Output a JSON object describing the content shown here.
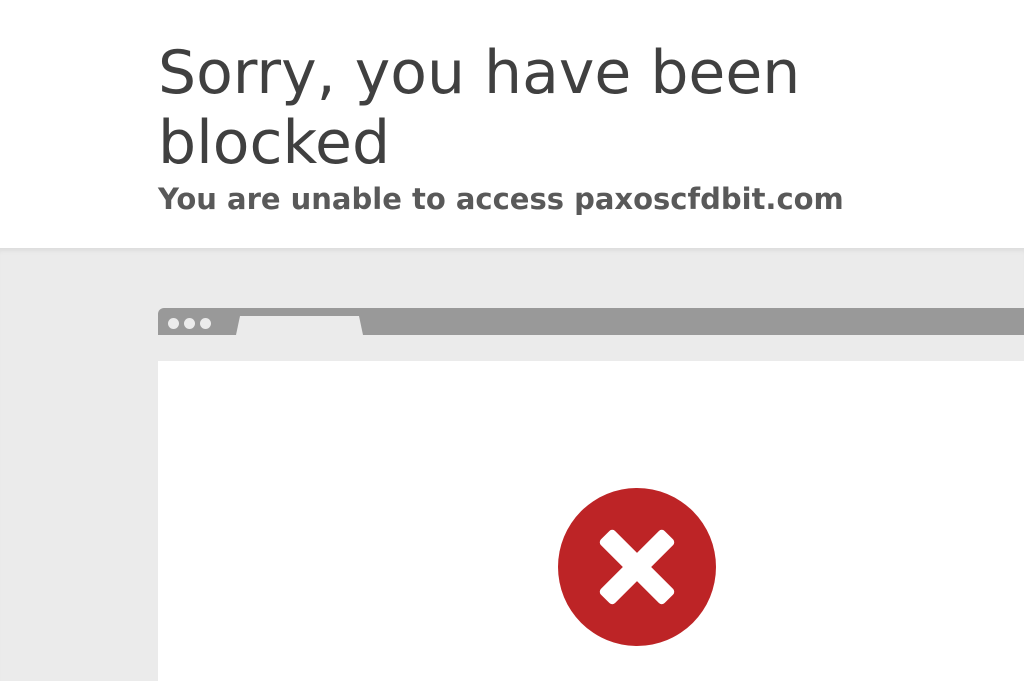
{
  "header": {
    "title": "Sorry, you have been blocked",
    "subtitle": "You are unable to access paxoscfdbit.com"
  },
  "icons": {
    "browser_dots": "three-dots-icon",
    "error": "error-x-icon"
  },
  "colors": {
    "title": "#404040",
    "subtitle": "#595959",
    "gray_background": "#ebebeb",
    "browser_bar": "#999999",
    "error_circle": "#bd2426",
    "error_cross": "#ffffff"
  }
}
